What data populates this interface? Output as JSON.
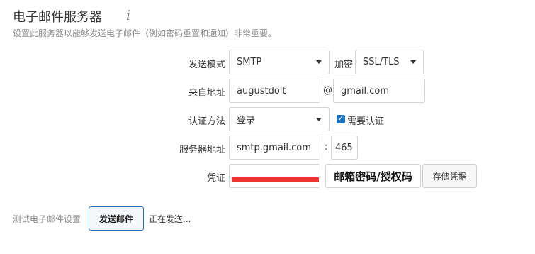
{
  "header": {
    "title": "电子邮件服务器",
    "info_icon": "i",
    "subtitle": "设置此服务器以能够发送电子邮件（例如密码重置和通知）非常重要。"
  },
  "form": {
    "send_mode": {
      "label": "发送模式",
      "value": "SMTP"
    },
    "encryption": {
      "label": "加密",
      "value": "SSL/TLS"
    },
    "from_address": {
      "label": "来自地址",
      "user": "augustdoit",
      "at": "@",
      "domain": "gmail.com"
    },
    "auth_method": {
      "label": "认证方法",
      "value": "登录",
      "require_auth_label": "需要认证",
      "require_auth_checked": true
    },
    "server_address": {
      "label": "服务器地址",
      "host": "smtp.gmail.com",
      "colon": ":",
      "port": "465"
    },
    "credentials": {
      "label": "凭证",
      "password_hint": "邮箱密码/授权码",
      "store_button": "存储凭据"
    }
  },
  "test": {
    "label": "测试电子邮件设置",
    "send_button": "发送邮件",
    "status": "正在发送..."
  },
  "colors": {
    "accent": "#1e73be",
    "redaction": "#e8332f"
  }
}
